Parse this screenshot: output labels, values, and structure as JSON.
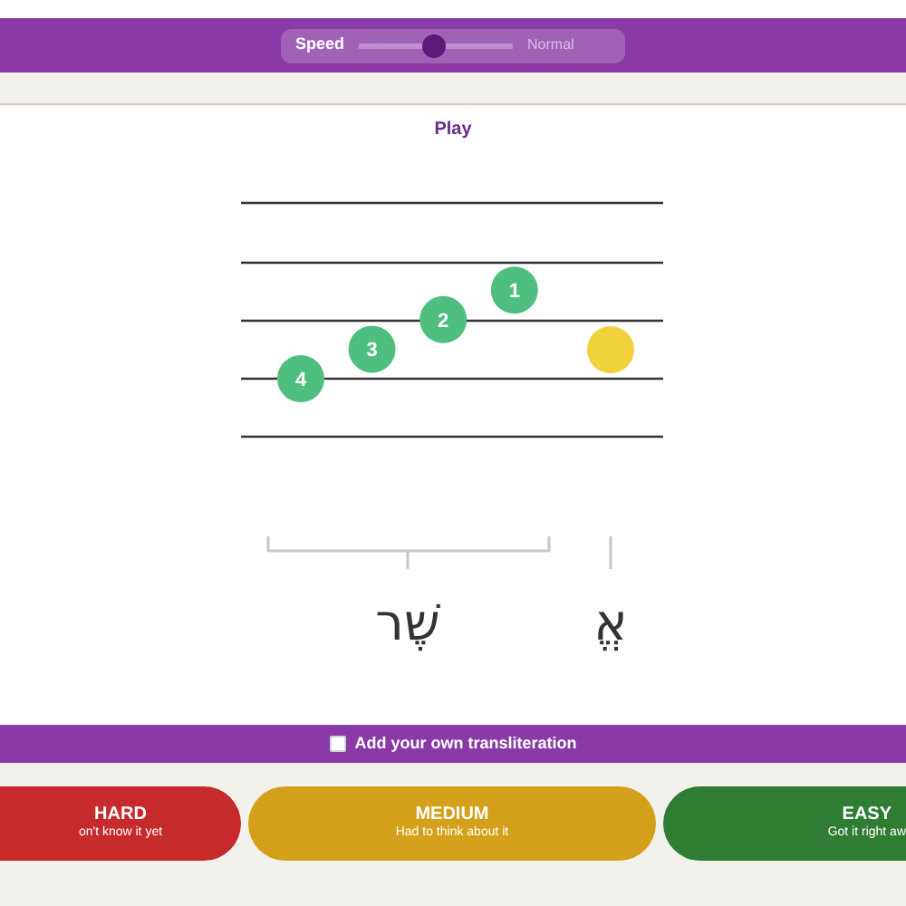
{
  "speed": {
    "label": "Speed",
    "level": 0.49,
    "reading": "Normal"
  },
  "play": {
    "label": "Play"
  },
  "notes": [
    {
      "kind": "numbered",
      "label": "4"
    },
    {
      "kind": "numbered",
      "label": "3"
    },
    {
      "kind": "numbered",
      "label": "2"
    },
    {
      "kind": "numbered",
      "label": "1"
    },
    {
      "kind": "current"
    }
  ],
  "syllables": [
    "אֱ",
    "שֶׁר"
  ],
  "transliteration": {
    "label": "Add your own transliteration",
    "checked": false
  },
  "buttons": [
    {
      "kind": "hard",
      "label": "HARD",
      "sub": "on't know it yet"
    },
    {
      "kind": "medium",
      "label": "MEDIUM",
      "sub": "Had to think about it"
    },
    {
      "kind": "easy",
      "label": "EASY",
      "sub": "Got it right aw"
    }
  ]
}
